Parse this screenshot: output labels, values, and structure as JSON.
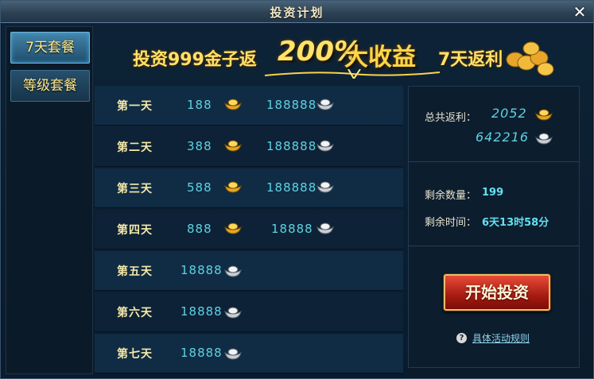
{
  "window": {
    "title": "投资计划",
    "close_glyph": "✕"
  },
  "tabs": [
    {
      "label": "7天套餐",
      "active": true
    },
    {
      "label": "等级套餐",
      "active": false
    }
  ],
  "banner": {
    "prefix": "投资999金子返",
    "percent": "200%",
    "big_text": "大收益",
    "suffix": "7天返利"
  },
  "days": [
    {
      "label": "第一天",
      "gold": "188",
      "silver": "188888"
    },
    {
      "label": "第二天",
      "gold": "388",
      "silver": "188888"
    },
    {
      "label": "第三天",
      "gold": "588",
      "silver": "188888"
    },
    {
      "label": "第四天",
      "gold": "888",
      "silver": "18888"
    },
    {
      "label": "第五天",
      "silver": "18888"
    },
    {
      "label": "第六天",
      "silver": "18888"
    },
    {
      "label": "第七天",
      "silver": "18888"
    }
  ],
  "info": {
    "total_label": "总共返利：",
    "total_gold": "2052",
    "total_silver": "642216",
    "remaining_count_label": "剩余数量：",
    "remaining_count": "199",
    "remaining_time_label": "剩余时间：",
    "remaining_time": "6天13时58分",
    "start_button": "开始投资",
    "rules_link": "具体活动规则",
    "help_glyph": "?"
  },
  "colors": {
    "accent_cyan": "#5fd2e3",
    "gold_text": "#ffe16a",
    "button_red": "#a51b12"
  }
}
